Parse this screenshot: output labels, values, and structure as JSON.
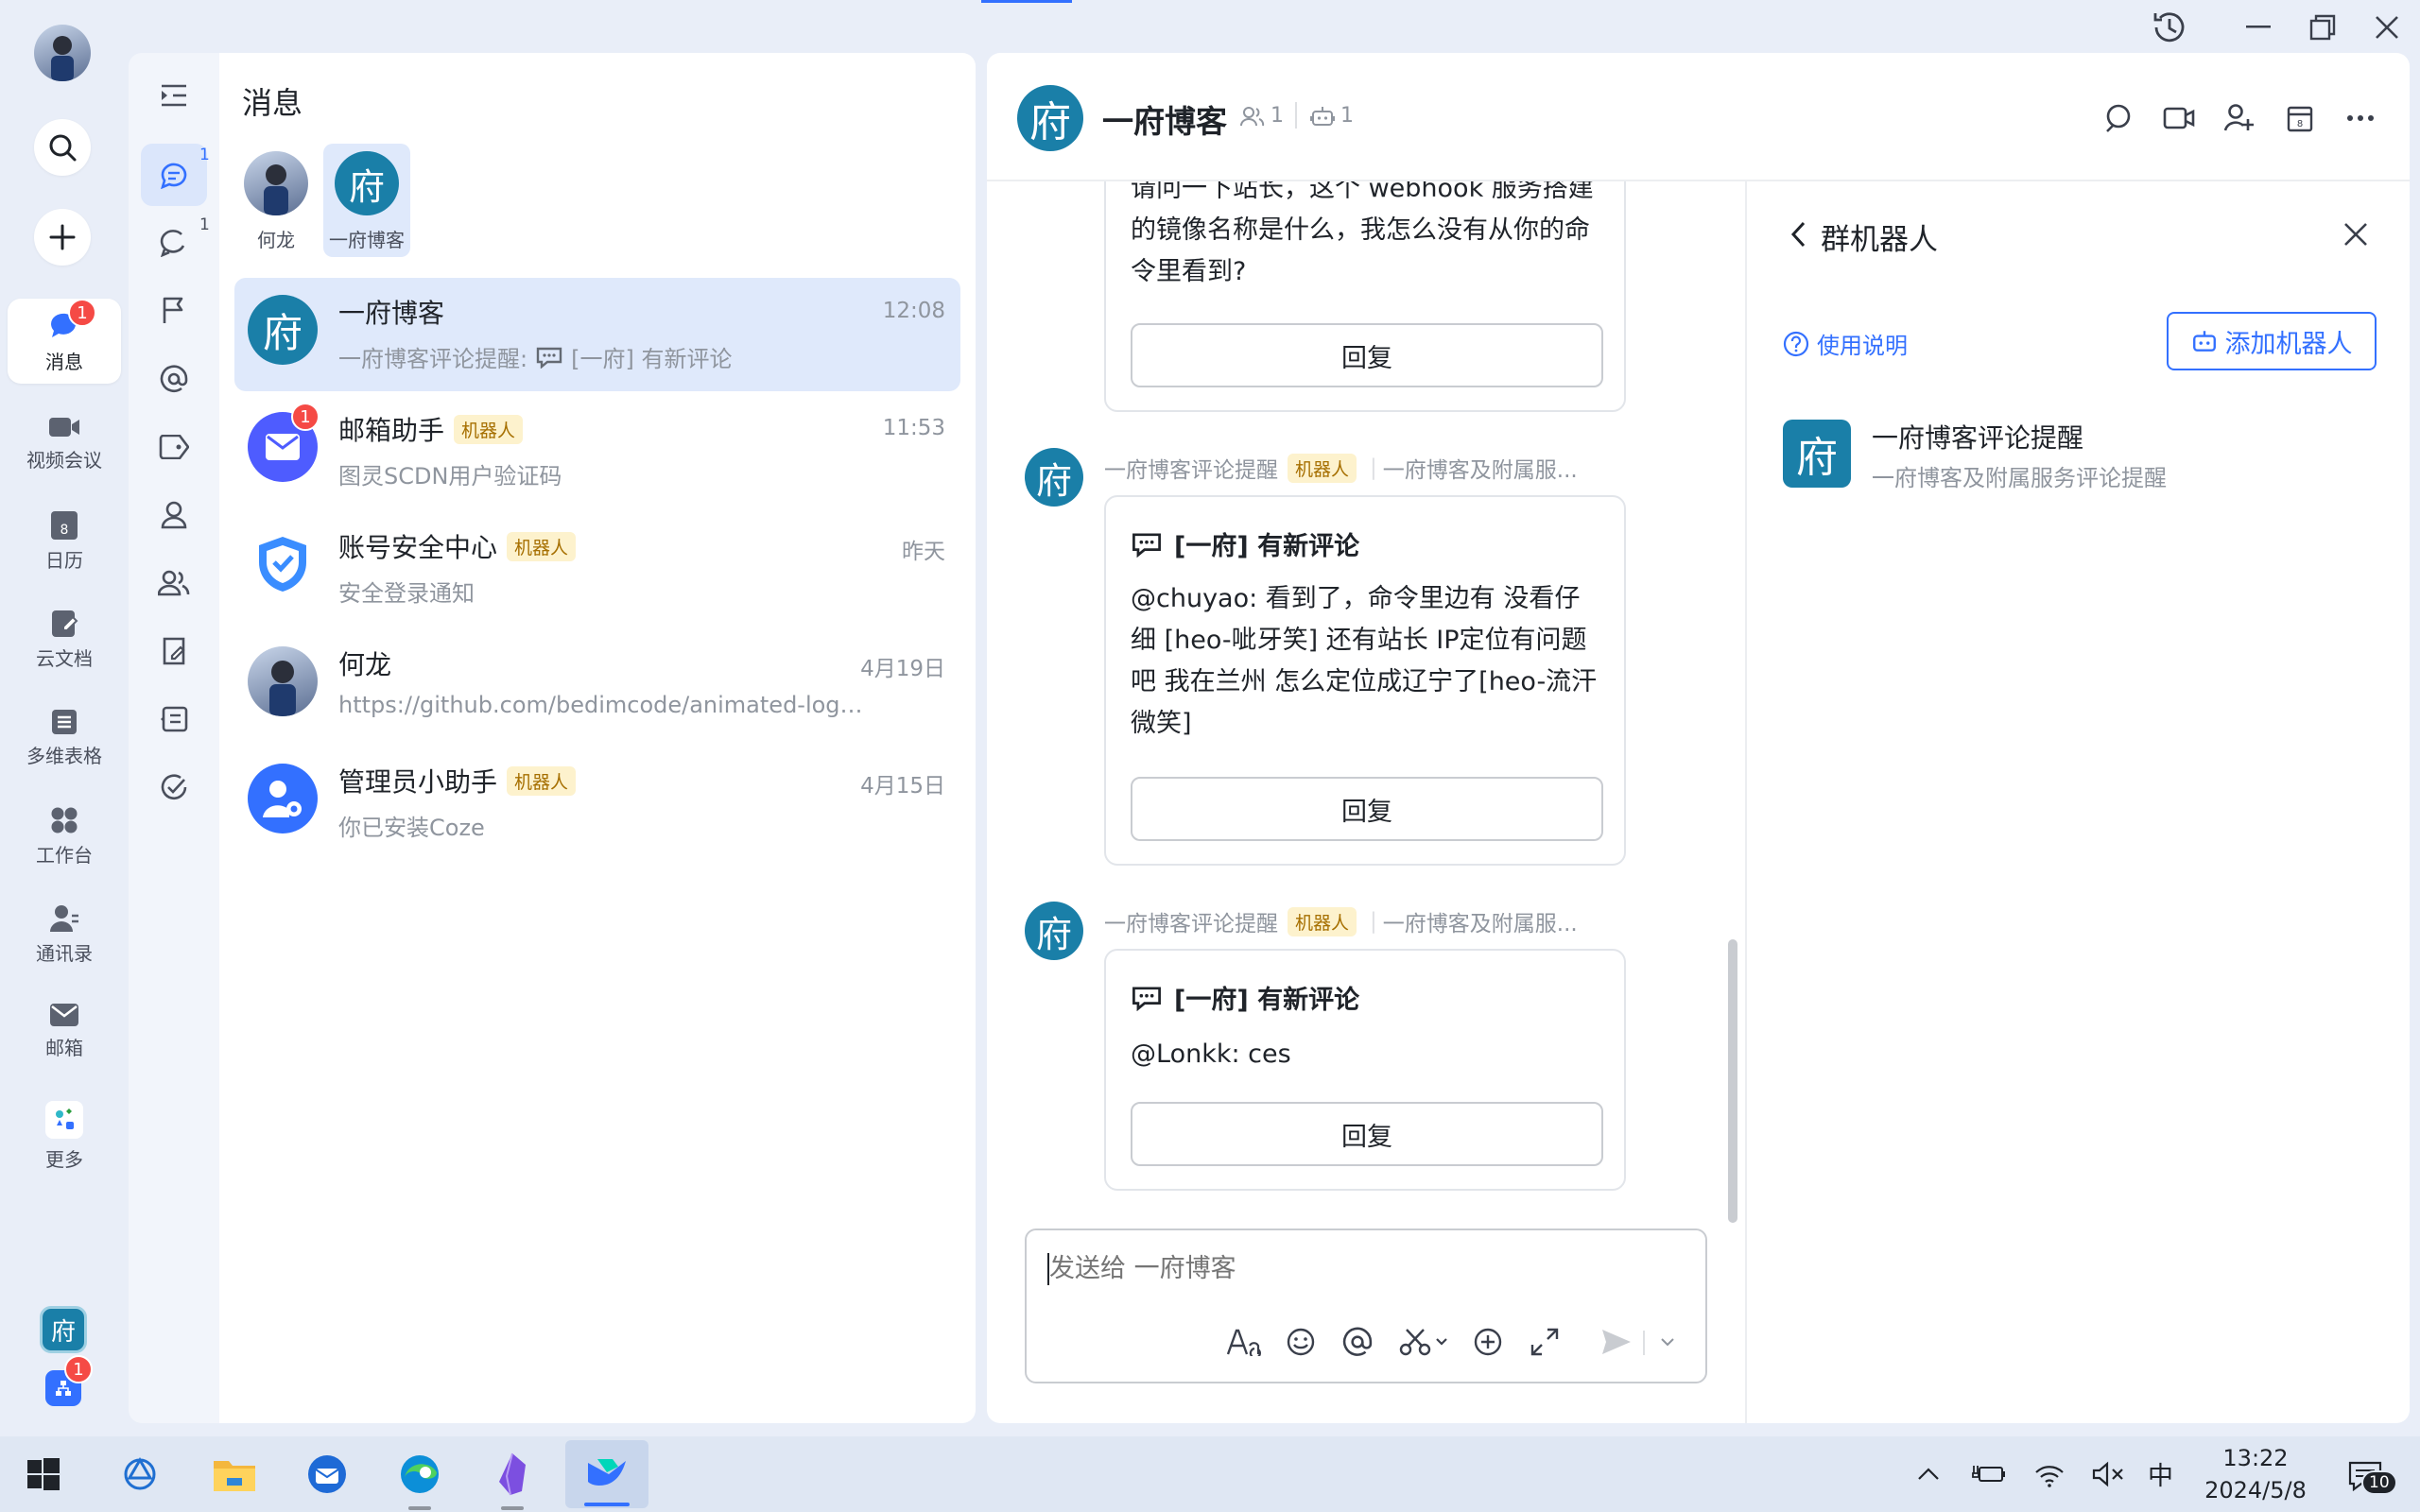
{
  "leftnav": {
    "items": [
      {
        "label": "消息",
        "badge": "1"
      },
      {
        "label": "视频会议"
      },
      {
        "label": "日历"
      },
      {
        "label": "云文档"
      },
      {
        "label": "多维表格"
      },
      {
        "label": "工作台"
      },
      {
        "label": "通讯录"
      },
      {
        "label": "邮箱"
      },
      {
        "label": "更多"
      }
    ],
    "calendar_day": "8",
    "bottom_app_badge": "1"
  },
  "subnav": {
    "chat_sup": "1",
    "thread_sup": "1"
  },
  "convlist": {
    "title": "消息",
    "pinned": [
      {
        "name": "何龙"
      },
      {
        "name": "一府博客"
      }
    ],
    "conversations": [
      {
        "name": "一府博客",
        "time": "12:08",
        "preview_prefix": "一府博客评论提醒:",
        "preview": "[一府] 有新评论"
      },
      {
        "name": "邮箱助手",
        "tag": "机器人",
        "time": "11:53",
        "preview": "图灵SCDN用户验证码",
        "badge": "1"
      },
      {
        "name": "账号安全中心",
        "tag": "机器人",
        "time": "昨天",
        "preview": "安全登录通知"
      },
      {
        "name": "何龙",
        "time": "4月19日",
        "preview": "https://github.com/bedimcode/animated-login-for..."
      },
      {
        "name": "管理员小助手",
        "tag": "机器人",
        "time": "4月15日",
        "preview": "你已安装Coze"
      }
    ]
  },
  "chat": {
    "avatar_char": "府",
    "title": "一府博客",
    "member_count": "1",
    "bot_count": "1",
    "messages": [
      {
        "body_top_cut": "请问一下站长，这个 webhook 服务搭建",
        "body_rest": "的镜像名称是什么，我怎么没有从你的命令里看到?",
        "reply": "回复"
      },
      {
        "sender": "一府博客评论提醒",
        "tag": "机器人",
        "source": "一府博客及附属服...",
        "title": "[一府] 有新评论",
        "body": "@chuyao: 看到了，命令里边有 没看仔细 [heo-呲牙笑] 还有站长 IP定位有问题吧 我在兰州 怎么定位成辽宁了[heo-流汗微笑]",
        "reply": "回复"
      },
      {
        "sender": "一府博客评论提醒",
        "tag": "机器人",
        "source": "一府博客及附属服...",
        "title": "[一府] 有新评论",
        "body": "@Lonkk: ces",
        "reply": "回复"
      }
    ],
    "input_placeholder": "发送给 一府博客"
  },
  "botpanel": {
    "title": "群机器人",
    "help_label": "使用说明",
    "add_label": "添加机器人",
    "bot": {
      "avatar_char": "府",
      "name": "一府博客评论提醒",
      "desc": "一府博客及附属服务评论提醒"
    }
  },
  "taskbar": {
    "ime": "中",
    "time": "13:22",
    "date": "2024/5/8",
    "notif_count": "10"
  },
  "colors": {
    "accent": "#3370ff",
    "fu_avatar": "#1a7fa8",
    "badge": "#f54a45",
    "bot_tag_bg": "#fdf2cd"
  }
}
